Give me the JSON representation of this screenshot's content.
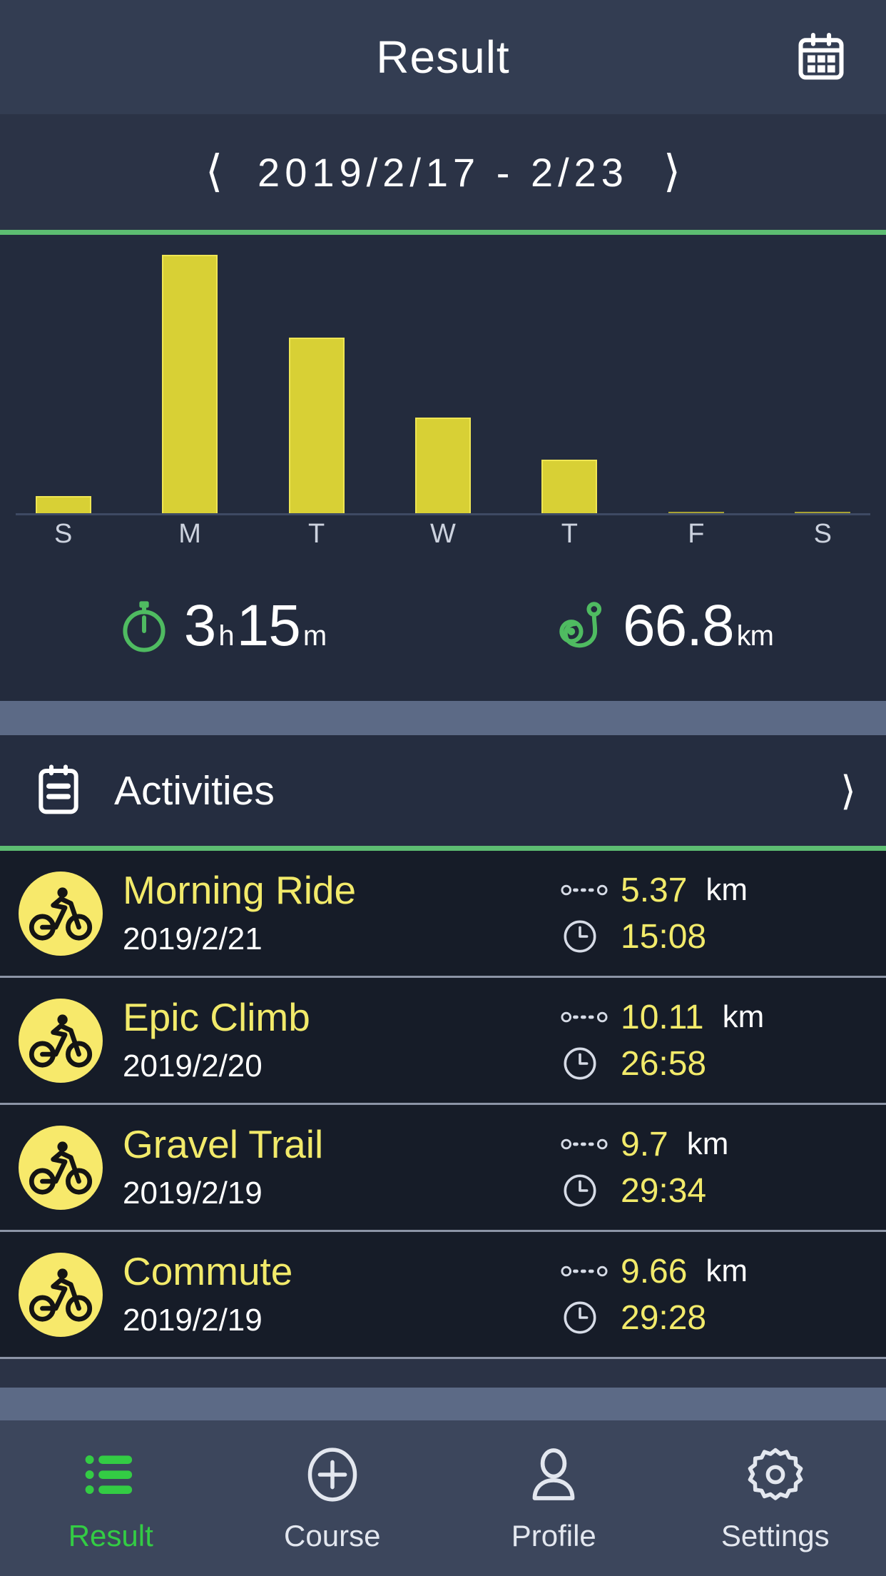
{
  "header": {
    "title": "Result",
    "calendar_icon": "calendar-icon"
  },
  "datebar": {
    "prev_icon": "chevron-left-icon",
    "next_icon": "chevron-right-icon",
    "range": "2019/2/17 - 2/23"
  },
  "chart_data": {
    "type": "bar",
    "title": "",
    "xlabel": "",
    "ylabel": "",
    "categories": [
      "S",
      "M",
      "T",
      "W",
      "T",
      "F",
      "S"
    ],
    "values": [
      0.29,
      3.95,
      2.7,
      1.48,
      0.84,
      0.04,
      0.04
    ],
    "ylim": [
      0,
      4.2
    ],
    "grid": false,
    "legend": "none",
    "bar_color": "#d8d035",
    "axis_color": "#3e4a63"
  },
  "summary": {
    "duration": {
      "icon": "stopwatch-icon",
      "hours": "3",
      "hours_unit": "h",
      "minutes": "15",
      "minutes_unit": "m"
    },
    "distance": {
      "icon": "route-pin-icon",
      "value": "66.8",
      "unit": "km"
    }
  },
  "activities_header": {
    "icon": "clipboard-icon",
    "title": "Activities",
    "chevron": "chevron-right-icon"
  },
  "activities": [
    {
      "avatar_icon": "cyclist-icon",
      "title": "Morning Ride",
      "date": "2019/2/21",
      "distance_icon": "route-dots-icon",
      "distance": "5.37",
      "distance_unit": "km",
      "time_icon": "clock-icon",
      "time": "15:08"
    },
    {
      "avatar_icon": "cyclist-icon",
      "title": "Epic Climb",
      "date": "2019/2/20",
      "distance_icon": "route-dots-icon",
      "distance": "10.11",
      "distance_unit": "km",
      "time_icon": "clock-icon",
      "time": "26:58"
    },
    {
      "avatar_icon": "cyclist-icon",
      "title": "Gravel Trail",
      "date": "2019/2/19",
      "distance_icon": "route-dots-icon",
      "distance": "9.7",
      "distance_unit": "km",
      "time_icon": "clock-icon",
      "time": "29:34"
    },
    {
      "avatar_icon": "cyclist-icon",
      "title": "Commute",
      "date": "2019/2/19",
      "distance_icon": "route-dots-icon",
      "distance": "9.66",
      "distance_unit": "km",
      "time_icon": "clock-icon",
      "time": "29:28"
    }
  ],
  "tabbar": {
    "items": [
      {
        "label": "Result",
        "icon": "list-icon",
        "active": true
      },
      {
        "label": "Course",
        "icon": "plus-circle-icon",
        "active": false
      },
      {
        "label": "Profile",
        "icon": "person-icon",
        "active": false
      },
      {
        "label": "Settings",
        "icon": "gear-icon",
        "active": false
      }
    ]
  },
  "colors": {
    "accent_green": "#5dbd72",
    "accent_yellow": "#d8d035",
    "active_tab_green": "#33cc44",
    "header_bg": "#333d52",
    "panel_bg": "#232b3d",
    "list_bg": "#161c28",
    "tabbar_bg": "#3c465c"
  }
}
